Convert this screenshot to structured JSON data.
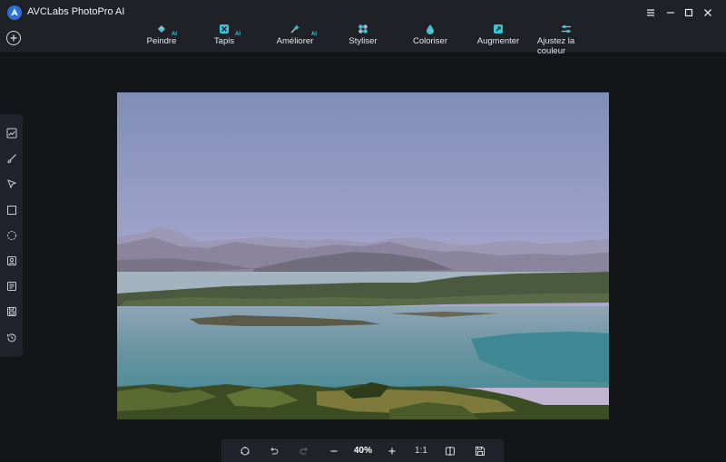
{
  "app": {
    "title": "AVCLabs PhotoPro AI"
  },
  "toolbar": {
    "tools": [
      {
        "label": "Peindre",
        "ai_badge": "AI"
      },
      {
        "label": "Tapis",
        "ai_badge": "AI"
      },
      {
        "label": "Améliorer",
        "ai_badge": "AI"
      },
      {
        "label": "Styliser",
        "ai_badge": ""
      },
      {
        "label": "Coloriser",
        "ai_badge": ""
      },
      {
        "label": "Augmenter",
        "ai_badge": ""
      },
      {
        "label_line1": "Ajustez la",
        "label_line2": "couleur",
        "ai_badge": ""
      }
    ]
  },
  "left_panel": {
    "icons": [
      "image-adjust-icon",
      "brush-icon",
      "select-arrow-icon",
      "rectangle-select-icon",
      "lasso-icon",
      "person-icon",
      "object-icon",
      "save-layer-icon",
      "history-icon"
    ]
  },
  "bottom_bar": {
    "zoom": "40%",
    "ratio": "1:1"
  },
  "colors": {
    "accent": "#2d6fd8",
    "ai_badge": "#37c5d8",
    "toolbar_bg": "#1e2227",
    "canvas_bg": "#131518"
  }
}
